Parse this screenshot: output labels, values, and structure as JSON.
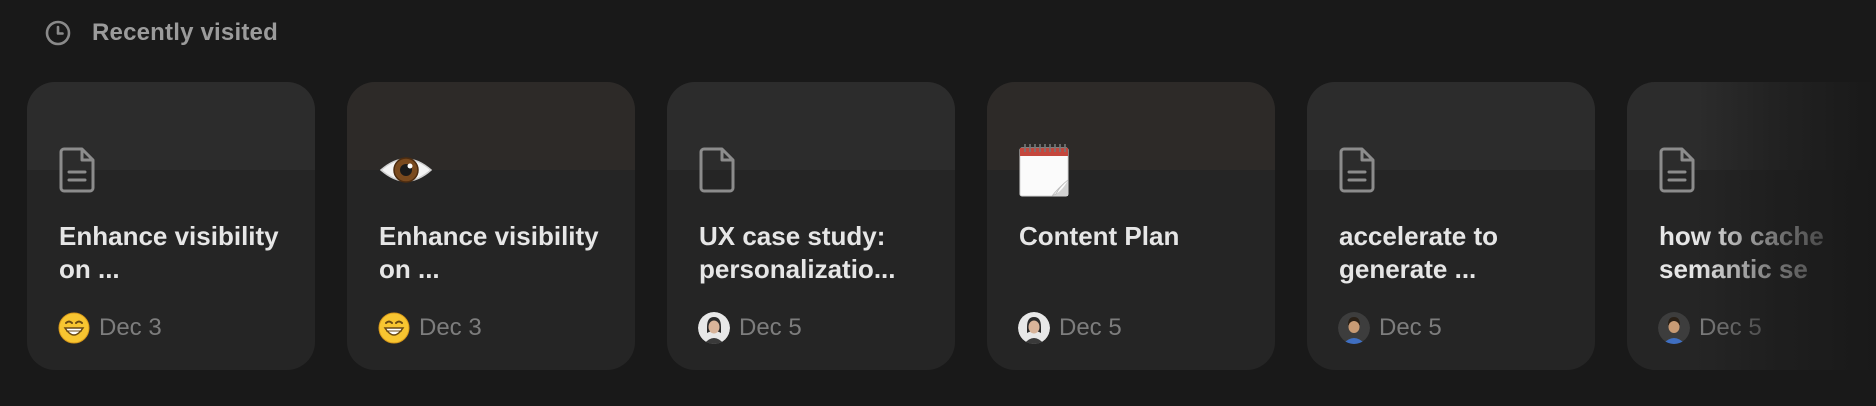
{
  "section": {
    "title": "Recently visited",
    "icon": "clock-icon"
  },
  "cards": [
    {
      "title": "Enhance visibility on ...",
      "icon": "document-icon",
      "avatar": "grinning-emoji-avatar",
      "date": "Dec 3"
    },
    {
      "title": "Enhance visibility on ...",
      "icon": "eye-emoji-icon",
      "avatar": "grinning-emoji-avatar",
      "date": "Dec 3"
    },
    {
      "title": "UX case study: personalizatio...",
      "icon": "document-icon",
      "avatar": "user-photo-avatar",
      "date": "Dec 5"
    },
    {
      "title": "Content Plan",
      "icon": "notepad-emoji-icon",
      "avatar": "user-photo-avatar",
      "date": "Dec 5"
    },
    {
      "title": "accelerate to generate ...",
      "icon": "document-icon",
      "avatar": "user-illustration-avatar",
      "date": "Dec 5"
    },
    {
      "title": "how to cache semantic se",
      "icon": "document-icon",
      "avatar": "user-illustration-avatar",
      "date": "Dec 5"
    }
  ],
  "colors": {
    "background": "#191919",
    "card": "#252525",
    "title_text": "#e6e6e6",
    "muted_text": "#7d7d7d"
  }
}
